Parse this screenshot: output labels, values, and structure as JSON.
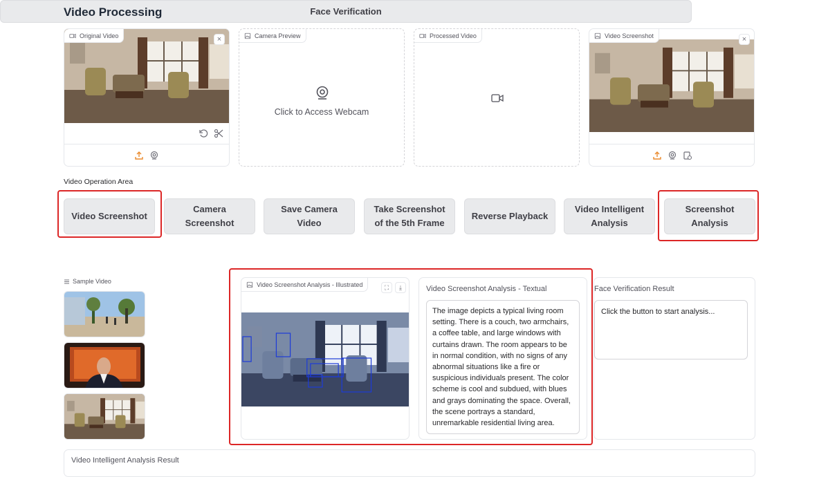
{
  "page": {
    "title": "Video Processing"
  },
  "panels": {
    "original_video": {
      "label": "Original Video",
      "close": "×"
    },
    "camera_preview": {
      "label": "Camera Preview",
      "webcam_text": "Click to Access Webcam"
    },
    "processed_video": {
      "label": "Processed Video"
    },
    "video_screenshot": {
      "label": "Video Screenshot",
      "close": "×"
    }
  },
  "operation_area": {
    "label": "Video Operation Area",
    "buttons": [
      {
        "label": "Video Screenshot"
      },
      {
        "label": "Camera Screenshot"
      },
      {
        "label": "Save Camera Video"
      },
      {
        "label": "Take Screenshot of the 5th Frame"
      },
      {
        "label": "Reverse Playback"
      },
      {
        "label": "Video Intelligent Analysis"
      },
      {
        "label": "Screenshot Analysis"
      }
    ],
    "face_verification": "Face Verification"
  },
  "samples": {
    "label": "Sample Video"
  },
  "analysis": {
    "illustrated_label": "Video Screenshot Analysis - Illustrated",
    "textual_label": "Video Screenshot Analysis - Textual",
    "textual_value": "The image depicts a typical living room setting. There is a couch, two armchairs, a coffee table, and large windows with curtains drawn. The room appears to be in normal condition, with no signs of any abnormal situations like a fire or suspicious individuals present. The color scheme is cool and subdued, with blues and grays dominating the space. Overall, the scene portrays a standard, unremarkable residential living area.",
    "face_label": "Face Verification Result",
    "face_value": "Click the button to start analysis..."
  },
  "bottom": {
    "label": "Video Intelligent Analysis Result"
  },
  "colors": {
    "highlight": "#dc2626",
    "accent_orange": "#ea8a2d",
    "button_bg": "#e9eaec"
  }
}
